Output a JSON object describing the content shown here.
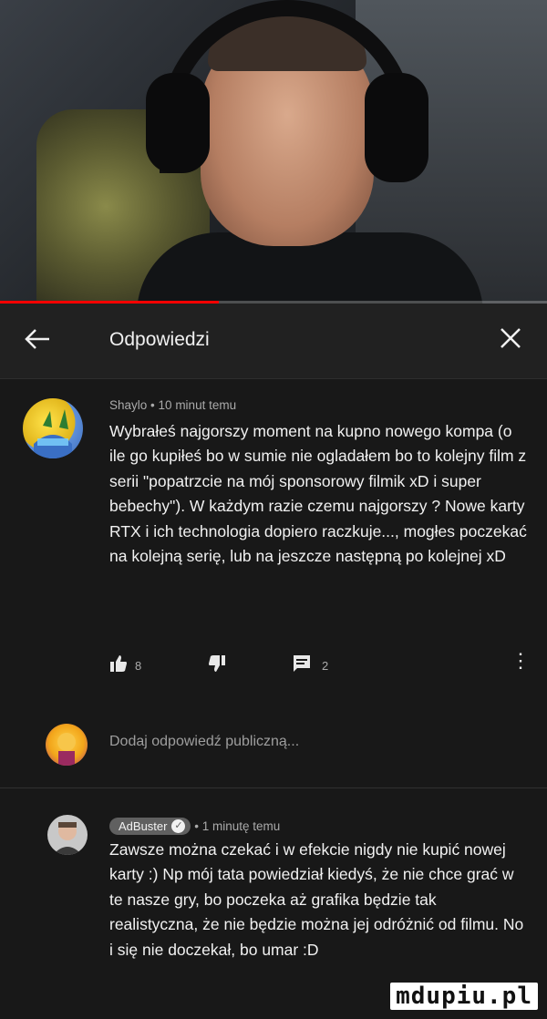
{
  "video": {
    "progress_percent": 40,
    "progress_color": "#ff0000"
  },
  "header": {
    "back_icon": "arrow-left",
    "title": "Odpowiedzi",
    "close_icon": "close-x"
  },
  "main_comment": {
    "author": "Shaylo",
    "separator": "•",
    "time": "10 minut temu",
    "text": "Wybrałeś najgorszy moment na kupno nowego kompa (o ile go kupiłeś bo w sumie nie ogladałem bo to kolejny film z serii \"popatrzcie na mój sponsorowy filmik xD i super bebechy\"). W każdym razie czemu najgorszy ? Nowe karty RTX i ich technologia dopiero raczkuje..., mogłes poczekać na kolejną serię, lub na jeszcze następną po kolejnej xD",
    "likes": "8",
    "replies": "2"
  },
  "reply_input": {
    "placeholder": "Dodaj odpowiedź publiczną..."
  },
  "reply_comment": {
    "author": "AdBuster",
    "separator": "•",
    "time": "1 minutę temu",
    "text": "Zawsze można czekać i w efekcie nigdy nie kupić nowej karty :) Np mój tata powiedział kiedyś, że nie chce grać w te nasze gry, bo poczeka aż grafika będzie tak realistyczna, że nie będzie można jej odróżnić od filmu. No i się nie doczekał, bo umar :D"
  },
  "watermark": "mdupiu.pl"
}
